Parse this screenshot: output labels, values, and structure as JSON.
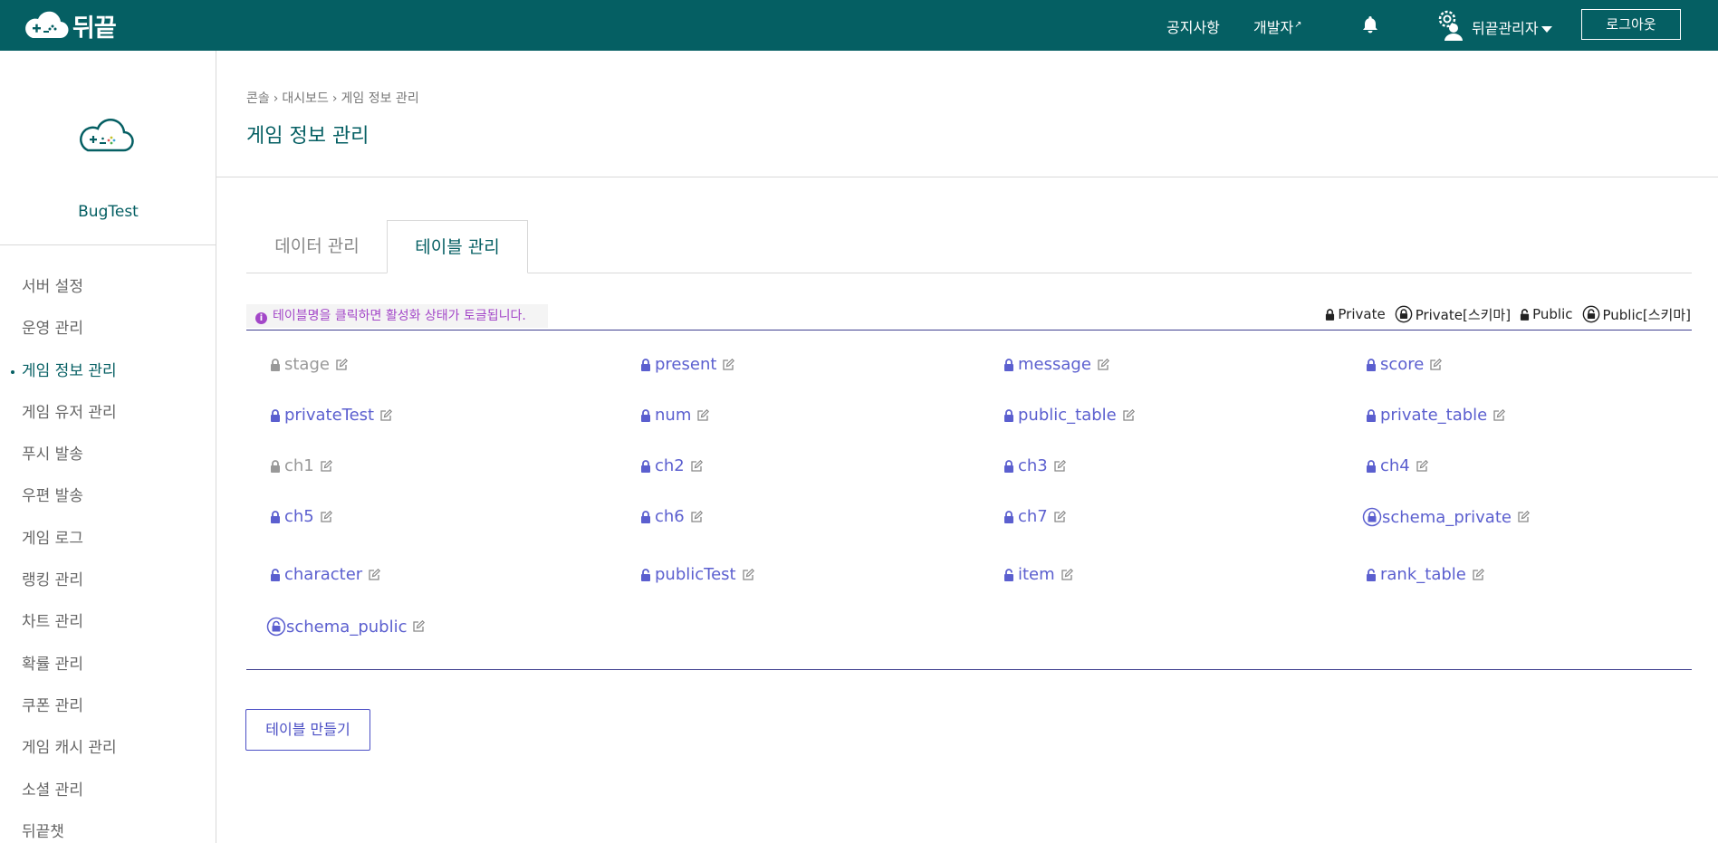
{
  "header": {
    "logo_text": "뒤끝",
    "notice_label": "공지사항",
    "developer_label": "개발자",
    "admin_label": "뒤끝관리자",
    "logout_label": "로그아웃"
  },
  "sidebar": {
    "project_name": "BugTest",
    "items": [
      {
        "label": "서버 설정",
        "active": false
      },
      {
        "label": "운영 관리",
        "active": false
      },
      {
        "label": "게임 정보 관리",
        "active": true
      },
      {
        "label": "게임 유저 관리",
        "active": false
      },
      {
        "label": "푸시 발송",
        "active": false
      },
      {
        "label": "우편 발송",
        "active": false
      },
      {
        "label": "게임 로그",
        "active": false
      },
      {
        "label": "랭킹 관리",
        "active": false
      },
      {
        "label": "차트 관리",
        "active": false
      },
      {
        "label": "확률 관리",
        "active": false
      },
      {
        "label": "쿠폰 관리",
        "active": false
      },
      {
        "label": "게임 캐시 관리",
        "active": false
      },
      {
        "label": "소셜 관리",
        "active": false
      },
      {
        "label": "뒤끝챗",
        "active": false
      }
    ]
  },
  "breadcrumb": [
    "콘솔",
    "대시보드",
    "게임 정보 관리"
  ],
  "breadcrumb_separator": "›",
  "page_title": "게임 정보 관리",
  "tabs": [
    {
      "label": "데이터 관리",
      "active": false
    },
    {
      "label": "테이블 관리",
      "active": true
    }
  ],
  "info_text": "테이블명을 클릭하면 활성화 상태가 토글됩니다.",
  "legend": {
    "private": "Private",
    "private_schema": "Private[스키마]",
    "public": "Public",
    "public_schema": "Public[스키마]"
  },
  "tables": [
    {
      "name": "stage",
      "type": "private",
      "active": false
    },
    {
      "name": "present",
      "type": "private",
      "active": true
    },
    {
      "name": "message",
      "type": "private",
      "active": true
    },
    {
      "name": "score",
      "type": "private",
      "active": true
    },
    {
      "name": "privateTest",
      "type": "private",
      "active": true
    },
    {
      "name": "num",
      "type": "private",
      "active": true
    },
    {
      "name": "public_table",
      "type": "private",
      "active": true
    },
    {
      "name": "private_table",
      "type": "private",
      "active": true
    },
    {
      "name": "ch1",
      "type": "private",
      "active": false
    },
    {
      "name": "ch2",
      "type": "private",
      "active": true
    },
    {
      "name": "ch3",
      "type": "private",
      "active": true
    },
    {
      "name": "ch4",
      "type": "private",
      "active": true
    },
    {
      "name": "ch5",
      "type": "private",
      "active": true
    },
    {
      "name": "ch6",
      "type": "private",
      "active": true
    },
    {
      "name": "ch7",
      "type": "private",
      "active": true
    },
    {
      "name": "schema_private",
      "type": "private_schema",
      "active": true
    },
    {
      "name": "character",
      "type": "public",
      "active": true
    },
    {
      "name": "publicTest",
      "type": "public",
      "active": true
    },
    {
      "name": "item",
      "type": "public",
      "active": true
    },
    {
      "name": "rank_table",
      "type": "public",
      "active": true
    },
    {
      "name": "schema_public",
      "type": "public_schema",
      "active": true
    }
  ],
  "create_button_label": "테이블 만들기",
  "colors": {
    "topbar": "#055f63",
    "active_table": "#5b5fcf",
    "inactive_table": "#999999",
    "info_text": "#a347c8"
  }
}
